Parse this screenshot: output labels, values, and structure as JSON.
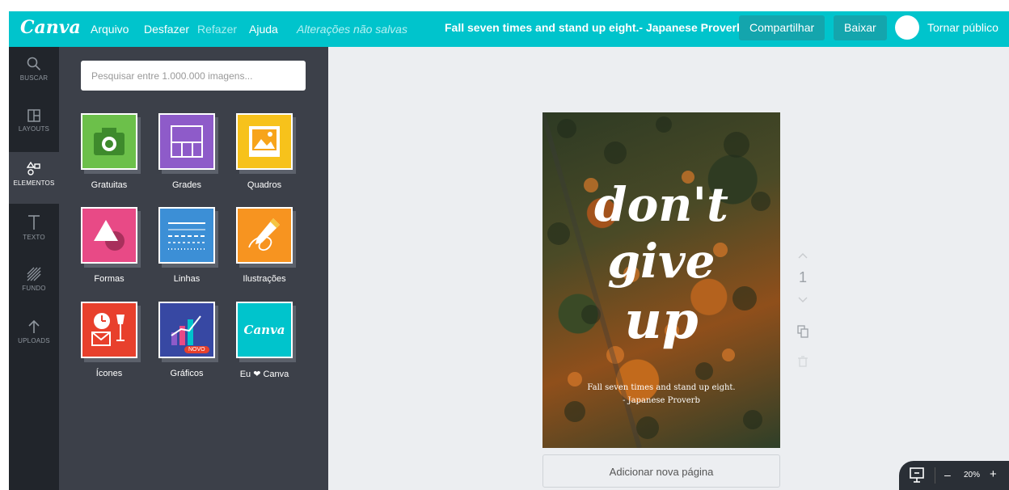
{
  "app": {
    "logo": "Canva"
  },
  "menu": {
    "file": "Arquivo",
    "undo": "Desfazer",
    "redo": "Refazer",
    "help": "Ajuda",
    "status": "Alterações não salvas"
  },
  "document": {
    "title": "Fall seven times and stand up eight.- Japanese Proverb"
  },
  "actions": {
    "share": "Compartilhar",
    "download": "Baixar",
    "public": "Tornar público"
  },
  "rail": [
    {
      "label": "BUSCAR",
      "icon": "search-icon"
    },
    {
      "label": "LAYOUTS",
      "icon": "layouts-icon"
    },
    {
      "label": "ELEMENTOS",
      "icon": "elements-icon"
    },
    {
      "label": "TEXTO",
      "icon": "text-icon"
    },
    {
      "label": "FUNDO",
      "icon": "background-icon"
    },
    {
      "label": "UPLOADS",
      "icon": "upload-icon"
    }
  ],
  "panel": {
    "search_placeholder": "Pesquisar entre 1.000.000 imagens...",
    "tiles": [
      {
        "label": "Gratuitas",
        "color": "#6cc04a"
      },
      {
        "label": "Grades",
        "color": "#8e5bc9"
      },
      {
        "label": "Quadros",
        "color": "#f7c21b"
      },
      {
        "label": "Formas",
        "color": "#e84a86"
      },
      {
        "label": "Linhas",
        "color": "#3c8fd6"
      },
      {
        "label": "Ilustrações",
        "color": "#f79420"
      },
      {
        "label": "Ícones",
        "color": "#e8402c"
      },
      {
        "label": "Gráficos",
        "color": "#3748a3",
        "badge": "NOVO"
      },
      {
        "label": "Eu ❤ Canva",
        "color": "#00c4cc",
        "card_text": "Canva"
      }
    ]
  },
  "design": {
    "script_lines": [
      "don't",
      "give",
      "up"
    ],
    "quote_line1": "Fall seven times and stand up eight.",
    "quote_line2": "- Japanese Proverb"
  },
  "pages": {
    "current": "1",
    "add_page": "Adicionar nova página"
  },
  "zoom": {
    "level": "20%"
  }
}
